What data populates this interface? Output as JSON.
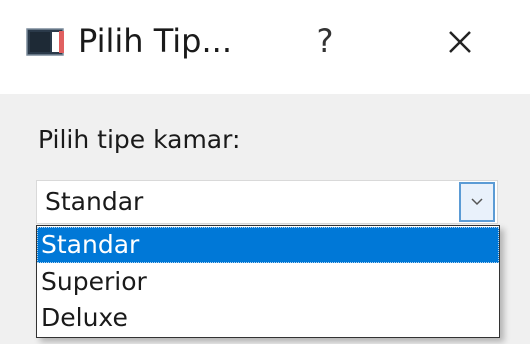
{
  "window": {
    "title": "Pilih Tip...",
    "help_label": "?"
  },
  "form": {
    "prompt": "Pilih tipe kamar:",
    "selected_value": "Standar"
  },
  "dropdown": {
    "options": [
      "Standar",
      "Superior",
      "Deluxe"
    ],
    "highlighted_index": 0
  },
  "colors": {
    "highlight": "#0078d7",
    "arrow_border": "#5b9bd5"
  }
}
